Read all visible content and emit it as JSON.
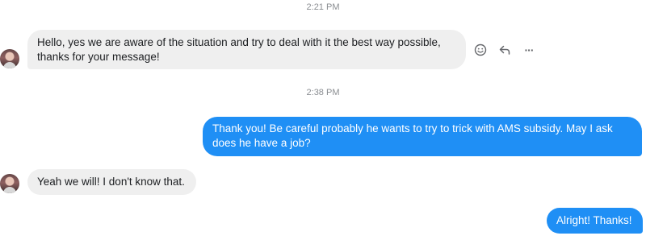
{
  "conversation": {
    "timestamps": [
      "2:21 PM",
      "2:38 PM"
    ],
    "messages": [
      {
        "direction": "incoming",
        "line1": "Hello, yes we are aware of the situation and try to deal with it the best way possible,",
        "line2": "thanks for your message!"
      },
      {
        "direction": "outgoing",
        "line1": "Thank you! Be careful probably he wants to try to trick with AMS subsidy. May I ask",
        "line2": "does he have a job?"
      },
      {
        "direction": "incoming",
        "line1": "Yeah we will! I don't know that."
      },
      {
        "direction": "outgoing",
        "line1": "Alright! Thanks!"
      }
    ],
    "message_actions": [
      {
        "icon": "emoji-react-icon"
      },
      {
        "icon": "reply-icon"
      },
      {
        "icon": "more-options-icon",
        "glyph": "···"
      }
    ]
  },
  "colors": {
    "outgoing_bubble": "#1f8ff5",
    "incoming_bubble": "#efefef",
    "timestamp_text": "#8a8d91"
  }
}
